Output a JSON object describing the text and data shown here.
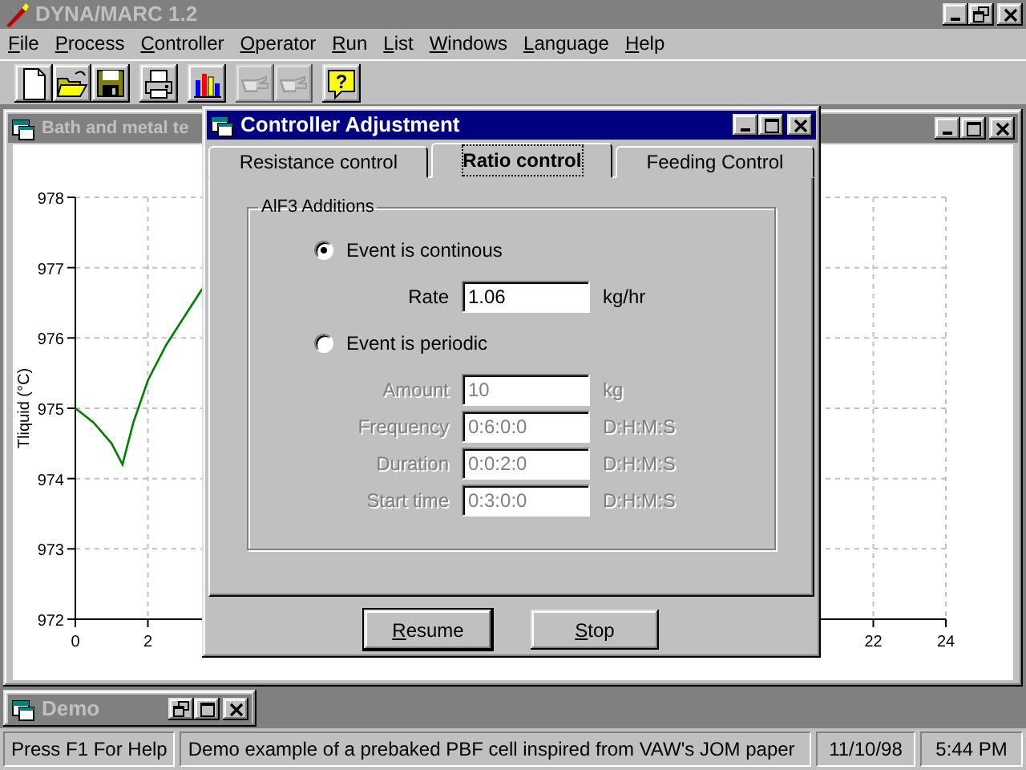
{
  "app": {
    "title": "DYNA/MARC 1.2"
  },
  "menu": [
    {
      "label": "File"
    },
    {
      "label": "Process"
    },
    {
      "label": "Controller"
    },
    {
      "label": "Operator"
    },
    {
      "label": "Run"
    },
    {
      "label": "List"
    },
    {
      "label": "Windows"
    },
    {
      "label": "Language"
    },
    {
      "label": "Help"
    }
  ],
  "toolbar": [
    [
      {
        "kind": "new",
        "disabled": false
      },
      {
        "kind": "open",
        "disabled": false
      },
      {
        "kind": "save",
        "disabled": false
      }
    ],
    [
      {
        "kind": "print",
        "disabled": false
      }
    ],
    [
      {
        "kind": "chart",
        "disabled": false
      }
    ],
    [
      {
        "kind": "hand",
        "disabled": true
      },
      {
        "kind": "hand",
        "disabled": true
      }
    ],
    [
      {
        "kind": "help",
        "disabled": false,
        "glyph": "?"
      }
    ]
  ],
  "chart_window": {
    "title": "Bath and metal te",
    "chart_data": {
      "type": "line",
      "ylabel": "Tliquid (°C)",
      "x": [
        0,
        0.5,
        1,
        1.3,
        1.6,
        2,
        2.5,
        3,
        3.5
      ],
      "grid": true,
      "series": [
        {
          "color": "#008000",
          "values": [
            975,
            974.8,
            974.5,
            974.2,
            974.8,
            975.4,
            975.9,
            976.3,
            976.7
          ]
        }
      ],
      "xlim": [
        0,
        24
      ],
      "ylim": [
        972,
        978
      ],
      "xticks": [
        0,
        2,
        22,
        24
      ],
      "yticks": [
        972,
        973,
        974,
        975,
        976,
        977,
        978
      ]
    }
  },
  "dialog": {
    "title": "Controller Adjustment",
    "tabs": [
      {
        "label": "Resistance control",
        "selected": false
      },
      {
        "label": "Ratio control",
        "selected": true
      },
      {
        "label": "Feeding Control",
        "selected": false
      }
    ],
    "group": {
      "title": "AlF3 Additions",
      "items": [
        {
          "kind": "radio",
          "label": "Event is continous",
          "selected": true
        },
        {
          "kind": "field",
          "label": "Rate",
          "value": "1.06",
          "unit": "kg/hr",
          "disabled": false
        },
        {
          "kind": "radio",
          "label": "Event is periodic",
          "selected": false
        },
        {
          "kind": "field",
          "label": "Amount",
          "value": "10",
          "unit": "kg",
          "disabled": true
        },
        {
          "kind": "field",
          "label": "Frequency",
          "value": "0:6:0:0",
          "unit": "D:H:M:S",
          "disabled": true
        },
        {
          "kind": "field",
          "label": "Duration",
          "value": "0:0:2:0",
          "unit": "D:H:M:S",
          "disabled": true
        },
        {
          "kind": "field",
          "label": "Start time",
          "value": "0:3:0:0",
          "unit": "D:H:M:S",
          "disabled": true
        }
      ]
    },
    "buttons": [
      {
        "label": "Resume",
        "default": true
      },
      {
        "label": "Stop",
        "default": false
      }
    ]
  },
  "minimized_window": {
    "title": "Demo"
  },
  "status_bar": [
    "Press F1 For Help",
    "Demo example of a prebaked PBF cell inspired from VAW's JOM paper",
    "11/10/98",
    "5:44 PM"
  ]
}
